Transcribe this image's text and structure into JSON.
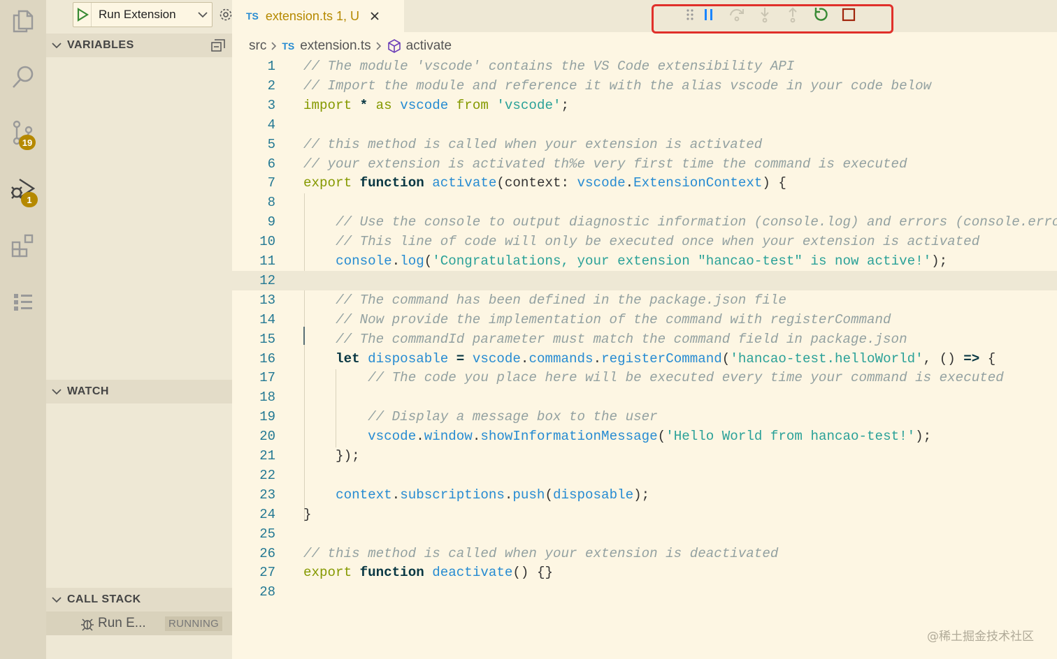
{
  "activity_bar": {
    "items": [
      {
        "icon": "files-icon"
      },
      {
        "icon": "search-icon"
      },
      {
        "icon": "source-control-icon",
        "badge": "19"
      },
      {
        "icon": "run-debug-icon",
        "badge": "1"
      },
      {
        "icon": "extensions-icon"
      },
      {
        "icon": "outline-icon"
      }
    ],
    "badge_color": "#b58900"
  },
  "debug_config": {
    "label": "Run Extension"
  },
  "sidebar": {
    "variables_title": "VARIABLES",
    "watch_title": "WATCH",
    "callstack_title": "CALL STACK",
    "callstack_item": {
      "name": "Run E...",
      "state": "RUNNING"
    }
  },
  "tab": {
    "lang": "TS",
    "name": "extension.ts 1, U"
  },
  "breadcrumb": {
    "folder": "src",
    "lang": "TS",
    "file": "extension.ts",
    "symbol": "activate"
  },
  "debug_toolbar": {
    "buttons": [
      "drag-grip-icon",
      "pause-icon",
      "step-over-icon",
      "step-into-icon",
      "step-out-icon",
      "restart-icon",
      "stop-icon"
    ],
    "highlight_color": "#e0302a"
  },
  "editor": {
    "line_numbers": [
      "1",
      "2",
      "3",
      "4",
      "5",
      "6",
      "7",
      "8",
      "9",
      "10",
      "11",
      "12",
      "13",
      "14",
      "15",
      "16",
      "17",
      "18",
      "19",
      "20",
      "21",
      "22",
      "23",
      "24",
      "25",
      "26",
      "27",
      "28"
    ],
    "current_line": 12,
    "lines": [
      "// The module 'vscode' contains the VS Code extensibility API",
      "// Import the module and reference it with the alias vscode in your code below",
      "import * as vscode from 'vscode';",
      "",
      "// this method is called when your extension is activated",
      "// your extension is activated th%e very first time the command is executed",
      "export function activate(context: vscode.ExtensionContext) {",
      "",
      "    // Use the console to output diagnostic information (console.log) and errors (console.error)",
      "    // This line of code will only be executed once when your extension is activated",
      "    console.log('Congratulations, your extension \"hancao-test\" is now active!');",
      "",
      "    // The command has been defined in the package.json file",
      "    // Now provide the implementation of the command with registerCommand",
      "    // The commandId parameter must match the command field in package.json",
      "    let disposable = vscode.commands.registerCommand('hancao-test.helloWorld', () => {",
      "        // The code you place here will be executed every time your command is executed",
      "",
      "        // Display a message box to the user",
      "        vscode.window.showInformationMessage('Hello World from hancao-test!');",
      "    });",
      "",
      "    context.subscriptions.push(disposable);",
      "}",
      "",
      "// this method is called when your extension is deactivated",
      "export function deactivate() {}",
      ""
    ]
  },
  "watermark": "@稀土掘金技术社区"
}
